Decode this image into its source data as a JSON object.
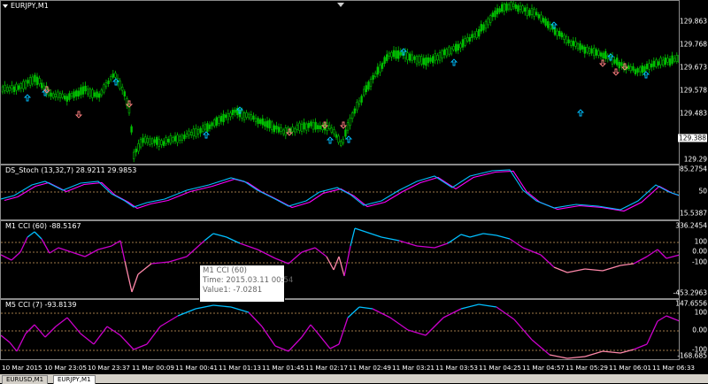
{
  "main": {
    "title": "EURJPY,M1",
    "axis": [
      "129.863",
      "129.768",
      "129.673",
      "129.578",
      "129.483",
      "129.388",
      "129.29"
    ],
    "current": "129.388"
  },
  "stoch": {
    "title": "DS_Stoch (13,32,7) 28.9211 29.9853",
    "axis": [
      "85.2754",
      "50",
      "15.5387"
    ]
  },
  "cci1": {
    "title": "M1 CCI (60) -88.5167",
    "axis": [
      "336.2454",
      "100",
      "0.00",
      "-100",
      "-453.2963"
    ]
  },
  "cci5": {
    "title": "M5 CCI (7) -93.8139",
    "axis": [
      "147.6556",
      "100",
      "0.00",
      "-100",
      "-168.685"
    ]
  },
  "tooltip": {
    "line1": "M1 CCI (60)",
    "line2": "Time: 2015.03.11 00:54",
    "line3": "Value1: -7.0281"
  },
  "times": [
    "10 Mar 2015",
    "10 Mar 23:05",
    "10 Mar 23:37",
    "11 Mar 00:09",
    "11 Mar 00:41",
    "11 Mar 01:13",
    "11 Mar 01:45",
    "11 Mar 02:17",
    "11 Mar 02:49",
    "11 Mar 03:21",
    "11 Mar 03:53",
    "11 Mar 04:25",
    "11 Mar 04:57",
    "11 Mar 05:29",
    "11 Mar 06:01",
    "11 Mar 06:33"
  ],
  "tabs": [
    "EURUSD,M1",
    "EURJPY,M1"
  ],
  "colors": {
    "candle": "#00c000",
    "stochMain": "#00bfff",
    "stochSignal": "#ff00ff",
    "cciHigh": "#00bfff",
    "cciMid": "#cc00cc",
    "cciLow": "#ff88aa",
    "level": "#d2a060",
    "arrowUp": "#00bfff",
    "arrowDown": "#ff8080"
  }
}
